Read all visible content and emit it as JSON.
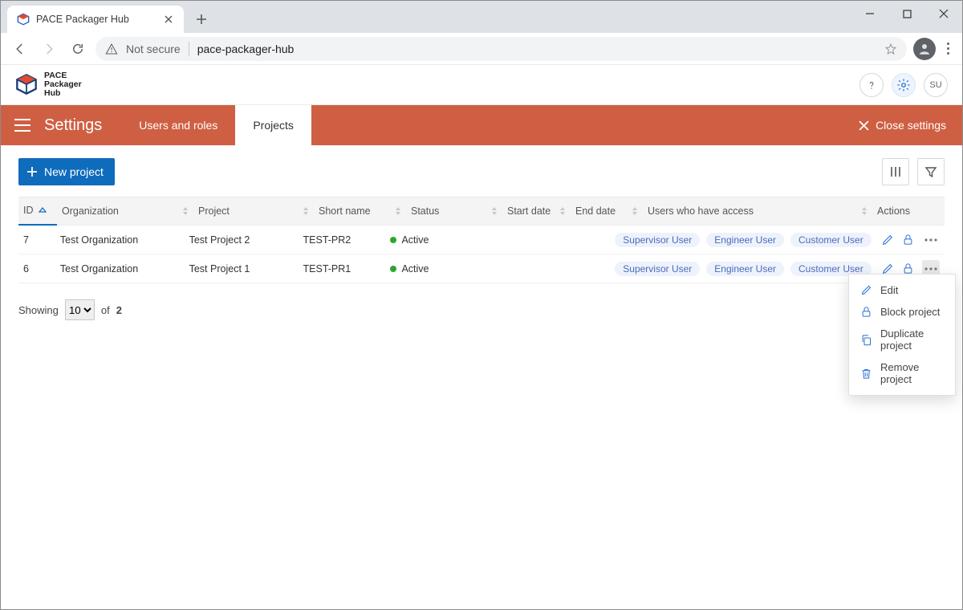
{
  "browser": {
    "tab_title": "PACE Packager Hub",
    "security_label": "Not secure",
    "url": "pace-packager-hub"
  },
  "brand": {
    "line1": "PACE",
    "line2": "Packager",
    "line3": "Hub"
  },
  "user_badge": "SU",
  "settings": {
    "title": "Settings",
    "tabs": {
      "users": "Users and roles",
      "projects": "Projects"
    },
    "close": "Close settings"
  },
  "toolbar": {
    "new_project": "New project"
  },
  "columns": {
    "id": "ID",
    "org": "Organization",
    "project": "Project",
    "short": "Short name",
    "status": "Status",
    "start": "Start date",
    "end": "End date",
    "users": "Users who have access",
    "actions": "Actions"
  },
  "status_label": "Active",
  "rows": [
    {
      "id": "7",
      "org": "Test Organization",
      "project": "Test Project 2",
      "short": "TEST-PR2",
      "users": [
        "Supervisor User",
        "Engineer User",
        "Customer User"
      ]
    },
    {
      "id": "6",
      "org": "Test Organization",
      "project": "Test Project 1",
      "short": "TEST-PR1",
      "users": [
        "Supervisor User",
        "Engineer User",
        "Customer User"
      ]
    }
  ],
  "paging": {
    "showing": "Showing",
    "page_size": "10",
    "of": "of",
    "total": "2"
  },
  "menu": {
    "edit": "Edit",
    "block": "Block project",
    "duplicate": "Duplicate project",
    "remove": "Remove project"
  }
}
